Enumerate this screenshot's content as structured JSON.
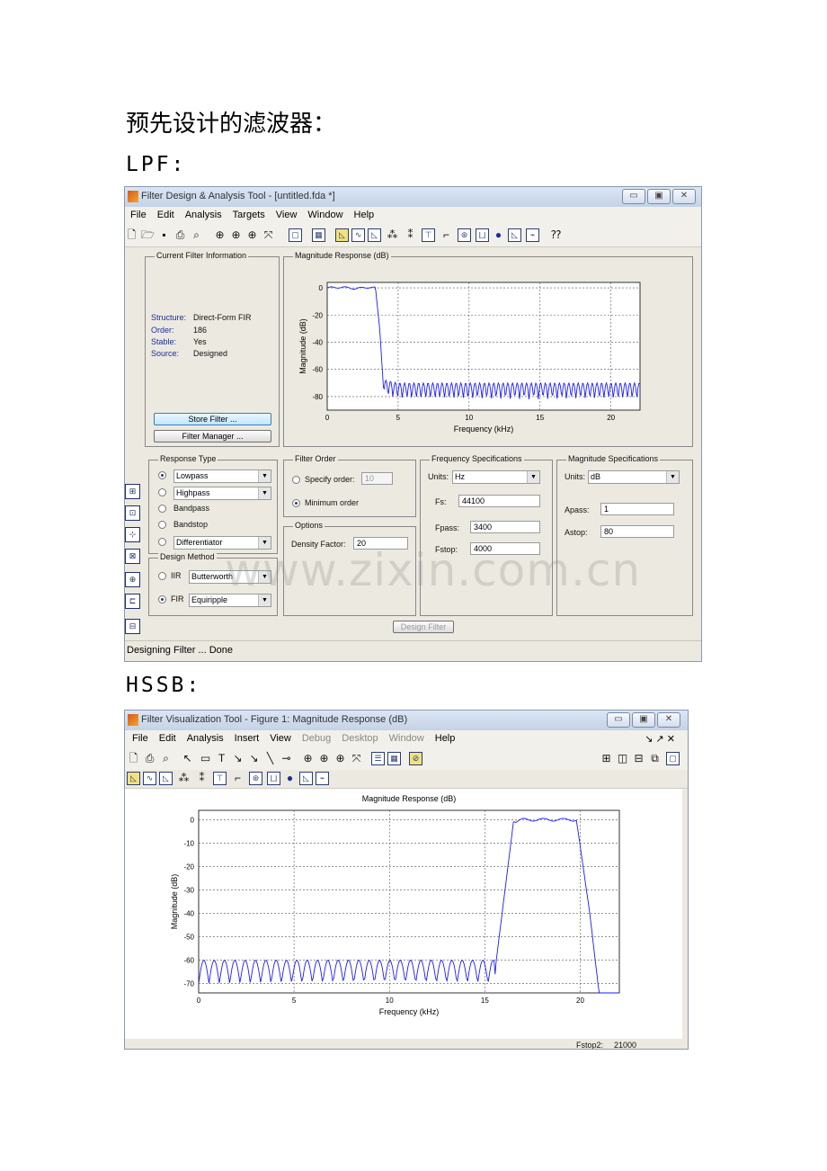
{
  "doc": {
    "heading": "预先设计的滤波器：",
    "lpf_label": "LPF:",
    "hssb_label": "HSSB:",
    "watermark": "www.zixin.com.cn"
  },
  "fda": {
    "title": "Filter Design & Analysis Tool -  [untitled.fda *]",
    "window_buttons": [
      "▭",
      "▣",
      "✕"
    ],
    "menu": [
      "File",
      "Edit",
      "Analysis",
      "Targets",
      "View",
      "Window",
      "Help"
    ],
    "info": {
      "group_label": "Current Filter Information",
      "structure_label": "Structure:",
      "structure": "Direct-Form FIR",
      "order_label": "Order:",
      "order": "186",
      "stable_label": "Stable:",
      "stable": "Yes",
      "source_label": "Source:",
      "source": "Designed",
      "store_button": "Store Filter ...",
      "manager_button": "Filter Manager ..."
    },
    "plot": {
      "group_label": "Magnitude Response (dB)",
      "xlabel": "Frequency (kHz)",
      "ylabel": "Magnitude (dB)"
    },
    "response_type": {
      "group_label": "Response Type",
      "lowpass": "Lowpass",
      "highpass": "Highpass",
      "bandpass": "Bandpass",
      "bandstop": "Bandstop",
      "differentiator": "Differentiator"
    },
    "design_method": {
      "group_label": "Design Method",
      "iir": "IIR",
      "iir_value": "Butterworth",
      "fir": "FIR",
      "fir_value": "Equiripple"
    },
    "filter_order": {
      "group_label": "Filter Order",
      "specify": "Specify order:",
      "specify_value": "10",
      "minimum": "Minimum order"
    },
    "options": {
      "group_label": "Options",
      "density_label": "Density Factor:",
      "density_value": "20"
    },
    "freq_specs": {
      "group_label": "Frequency Specifications",
      "units_label": "Units:",
      "units_value": "Hz",
      "fs_label": "Fs:",
      "fs_value": "44100",
      "fpass_label": "Fpass:",
      "fpass_value": "3400",
      "fstop_label": "Fstop:",
      "fstop_value": "4000"
    },
    "mag_specs": {
      "group_label": "Magnitude Specifications",
      "units_label": "Units:",
      "units_value": "dB",
      "apass_label": "Apass:",
      "apass_value": "1",
      "astop_label": "Astop:",
      "astop_value": "80"
    },
    "design_button": "Design Filter",
    "status": "Designing Filter ... Done"
  },
  "fvt": {
    "title": "Filter Visualization Tool - Figure 1: Magnitude Response (dB)",
    "window_buttons": [
      "▭",
      "▣",
      "✕"
    ],
    "menu": [
      "File",
      "Edit",
      "Analysis",
      "Insert",
      "View",
      "Debug",
      "Desktop",
      "Window",
      "Help"
    ],
    "menu_right": "↘ ↗ ✕",
    "plot": {
      "title": "Magnitude Response (dB)",
      "xlabel": "Frequency (kHz)",
      "ylabel": "Magnitude (dB)"
    },
    "behind_label": "Fstop2:",
    "behind_value": "21000"
  },
  "colors": {
    "trace": "#1a1aff",
    "grid": "#555555",
    "panel": "#ece9e0"
  },
  "chart_data": [
    {
      "type": "line",
      "series": [
        {
          "x": [
            0,
            1,
            2,
            3,
            3.4,
            3.7,
            4.0,
            4.2,
            5,
            10,
            15,
            20,
            22.05
          ],
          "y": [
            0,
            0.5,
            -0.5,
            0.5,
            0,
            -30,
            -80,
            -80,
            -82,
            -82,
            -82,
            -82,
            -82
          ]
        }
      ],
      "xticks": [
        0,
        5,
        10,
        15,
        20
      ],
      "yticks": [
        0,
        -20,
        -40,
        -60,
        -80
      ],
      "xlim": [
        0,
        22.05
      ],
      "ylim": [
        -90,
        4
      ],
      "xlabel": "Frequency (kHz)",
      "ylabel": "Magnitude (dB)",
      "grid": true
    },
    {
      "type": "line",
      "series": [
        {
          "x": [
            0,
            5,
            10,
            15,
            15.5,
            15.6,
            16.5,
            17,
            18,
            19,
            19.8,
            20.5,
            21
          ],
          "y": [
            -70,
            -70,
            -70,
            -70,
            -70,
            -60,
            -1,
            0,
            0,
            0,
            0,
            -40,
            -75
          ]
        }
      ],
      "xticks": [
        0,
        5,
        10,
        15,
        20
      ],
      "yticks": [
        0,
        -10,
        -20,
        -30,
        -40,
        -50,
        -60,
        -70
      ],
      "xlim": [
        0,
        22.05
      ],
      "ylim": [
        -74,
        4
      ],
      "title": "Magnitude Response (dB)",
      "xlabel": "Frequency (kHz)",
      "ylabel": "Magnitude (dB)",
      "grid": true
    }
  ]
}
